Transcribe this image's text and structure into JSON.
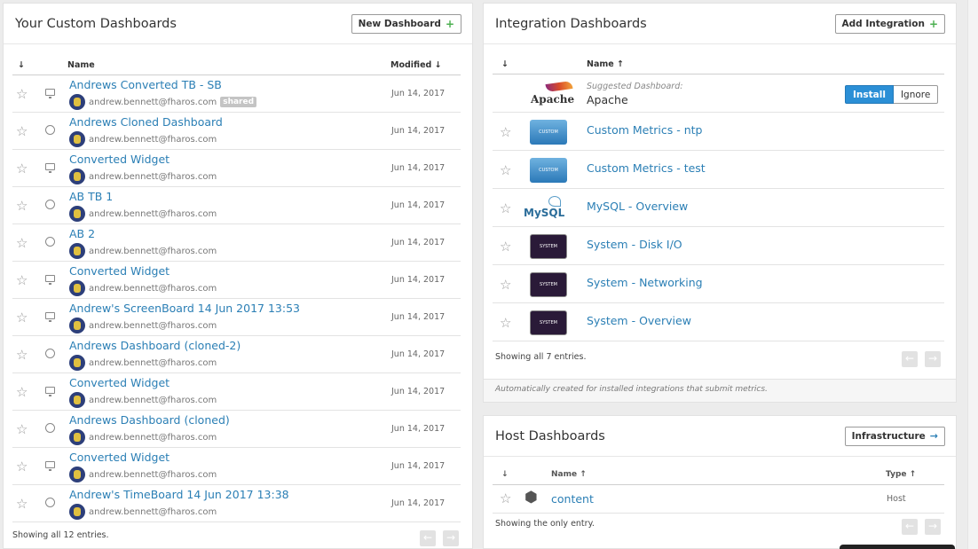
{
  "custom": {
    "title": "Your Custom Dashboards",
    "new_button": "New Dashboard",
    "col_sort": "↓",
    "col_name": "Name",
    "col_modified": "Modified ↓",
    "rows": [
      {
        "name": "Andrews Converted TB - SB",
        "user": "andrew.bennett@fharos.com",
        "date": "Jun 14, 2017",
        "type": "screen",
        "badge": "shared"
      },
      {
        "name": "Andrews Cloned Dashboard",
        "user": "andrew.bennett@fharos.com",
        "date": "Jun 14, 2017",
        "type": "time",
        "badge": ""
      },
      {
        "name": "Converted Widget",
        "user": "andrew.bennett@fharos.com",
        "date": "Jun 14, 2017",
        "type": "screen",
        "badge": ""
      },
      {
        "name": "AB TB 1",
        "user": "andrew.bennett@fharos.com",
        "date": "Jun 14, 2017",
        "type": "time",
        "badge": ""
      },
      {
        "name": "AB 2",
        "user": "andrew.bennett@fharos.com",
        "date": "Jun 14, 2017",
        "type": "time",
        "badge": ""
      },
      {
        "name": "Converted Widget",
        "user": "andrew.bennett@fharos.com",
        "date": "Jun 14, 2017",
        "type": "screen",
        "badge": ""
      },
      {
        "name": "Andrew's ScreenBoard 14 Jun 2017 13:53",
        "user": "andrew.bennett@fharos.com",
        "date": "Jun 14, 2017",
        "type": "screen",
        "badge": ""
      },
      {
        "name": "Andrews Dashboard (cloned-2)",
        "user": "andrew.bennett@fharos.com",
        "date": "Jun 14, 2017",
        "type": "time",
        "badge": ""
      },
      {
        "name": "Converted Widget",
        "user": "andrew.bennett@fharos.com",
        "date": "Jun 14, 2017",
        "type": "screen",
        "badge": ""
      },
      {
        "name": "Andrews Dashboard (cloned)",
        "user": "andrew.bennett@fharos.com",
        "date": "Jun 14, 2017",
        "type": "time",
        "badge": ""
      },
      {
        "name": "Converted Widget",
        "user": "andrew.bennett@fharos.com",
        "date": "Jun 14, 2017",
        "type": "screen",
        "badge": ""
      },
      {
        "name": "Andrew's TimeBoard 14 Jun 2017 13:38",
        "user": "andrew.bennett@fharos.com",
        "date": "Jun 14, 2017",
        "type": "time",
        "badge": ""
      }
    ],
    "footer": "Showing all 12 entries."
  },
  "integration": {
    "title": "Integration Dashboards",
    "add_button": "Add Integration",
    "col_sort": "↓",
    "col_name": "Name ↑",
    "suggested": {
      "logo_text": "Apache",
      "label": "Suggested Dashboard:",
      "name": "Apache",
      "install": "Install",
      "ignore": "Ignore"
    },
    "rows": [
      {
        "name": "Custom Metrics - ntp",
        "thumb": "custom",
        "thumb_text": "CUSTOM"
      },
      {
        "name": "Custom Metrics - test",
        "thumb": "custom",
        "thumb_text": "CUSTOM"
      },
      {
        "name": "MySQL - Overview",
        "thumb": "mysql",
        "thumb_text": "MySQL"
      },
      {
        "name": "System - Disk I/O",
        "thumb": "system",
        "thumb_text": "SYSTEM"
      },
      {
        "name": "System - Networking",
        "thumb": "system",
        "thumb_text": "SYSTEM"
      },
      {
        "name": "System - Overview",
        "thumb": "system",
        "thumb_text": "SYSTEM"
      }
    ],
    "footer": "Showing all 7 entries.",
    "note": "Automatically created for installed integrations that submit metrics."
  },
  "host": {
    "title": "Host Dashboards",
    "infra_button": "Infrastructure",
    "col_sort": "↓",
    "col_name": "Name ↑",
    "col_type": "Type ↑",
    "rows": [
      {
        "name": "content",
        "type": "Host"
      }
    ],
    "footer": "Showing the only entry."
  },
  "colors": {
    "link": "#2b7fb5",
    "install": "#2b8fd6",
    "plus": "#4caf50"
  }
}
